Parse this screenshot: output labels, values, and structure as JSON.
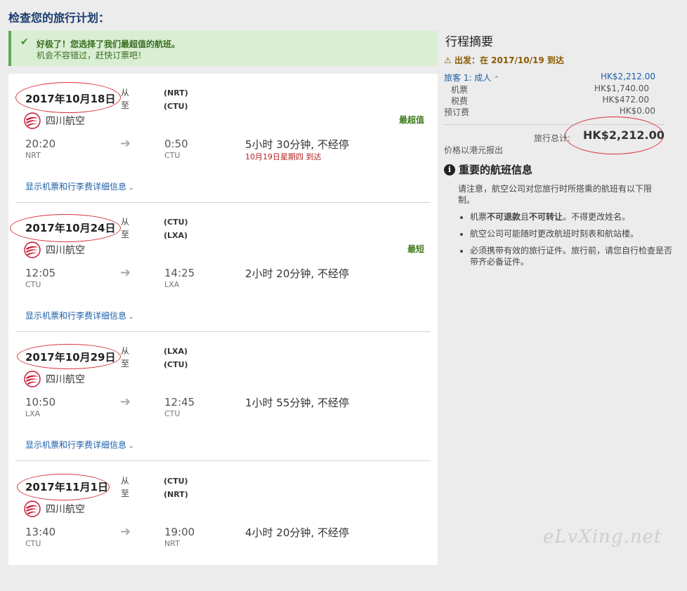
{
  "page": {
    "title": "检查您的旅行计划："
  },
  "alert": {
    "line1": "好极了！您选择了我们最超值的航班。",
    "line2": "机会不容错过，赶快订票吧！"
  },
  "labels": {
    "from": "从",
    "to": "至",
    "details": "显示机票和行李费详细信息"
  },
  "flights": [
    {
      "date": "2017年10月18日",
      "origin": "(NRT)",
      "destination": "(CTU)",
      "airline": "四川航空",
      "tag": "最超值",
      "dep_time": "20:20",
      "dep_code": "NRT",
      "arr_time": "0:50",
      "arr_code": "CTU",
      "duration": "5小时 30分钟, 不经停",
      "arrive_note": "10月19日星期四 到达"
    },
    {
      "date": "2017年10月24日",
      "origin": "(CTU)",
      "destination": "(LXA)",
      "airline": "四川航空",
      "tag": "最短",
      "dep_time": "12:05",
      "dep_code": "CTU",
      "arr_time": "14:25",
      "arr_code": "LXA",
      "duration": "2小时 20分钟, 不经停",
      "arrive_note": ""
    },
    {
      "date": "2017年10月29日",
      "origin": "(LXA)",
      "destination": "(CTU)",
      "airline": "四川航空",
      "tag": "",
      "dep_time": "10:50",
      "dep_code": "LXA",
      "arr_time": "12:45",
      "arr_code": "CTU",
      "duration": "1小时 55分钟, 不经停",
      "arrive_note": ""
    },
    {
      "date": "2017年11月1日",
      "origin": "(CTU)",
      "destination": "(NRT)",
      "airline": "四川航空",
      "tag": "",
      "dep_time": "13:40",
      "dep_code": "CTU",
      "arr_time": "19:00",
      "arr_code": "NRT",
      "duration": "4小时 20分钟, 不经停",
      "arrive_note": ""
    }
  ],
  "summary": {
    "title": "行程摘要",
    "depart": "出发：在 2017/10/19 到达",
    "traveler_label": "旅客 1: 成人",
    "traveler_amount": "HK$2,212.00",
    "fees": [
      {
        "label": "机票",
        "amount": "HK$1,740.00"
      },
      {
        "label": "税费",
        "amount": "HK$472.00"
      },
      {
        "label": "预订费",
        "amount": "HK$0.00"
      }
    ],
    "total_label": "旅行总计:",
    "total_amount": "HK$2,212.00",
    "currency_note": "价格以港元报出"
  },
  "info": {
    "title": "重要的航班信息",
    "para": "请注意，航空公司对您旅行时所搭乘的航班有以下限制。",
    "bullet1_prefix": "机票",
    "bullet1_bold1": "不可退款",
    "bullet1_mid": "且",
    "bullet1_bold2": "不可转让",
    "bullet1_suffix": "。不得更改姓名。",
    "bullet2": "航空公司可能随时更改航班时刻表和航站楼。",
    "bullet3": "必须携带有效的旅行证件。旅行前，请您自行检查是否带齐必备证件。"
  },
  "watermark": "eLvXing.net",
  "colors": {
    "accent_blue": "#1a5fa8",
    "title_navy": "#1a3b6e",
    "success_green": "#3f7d1f",
    "annotation_red": "#d8343c"
  }
}
